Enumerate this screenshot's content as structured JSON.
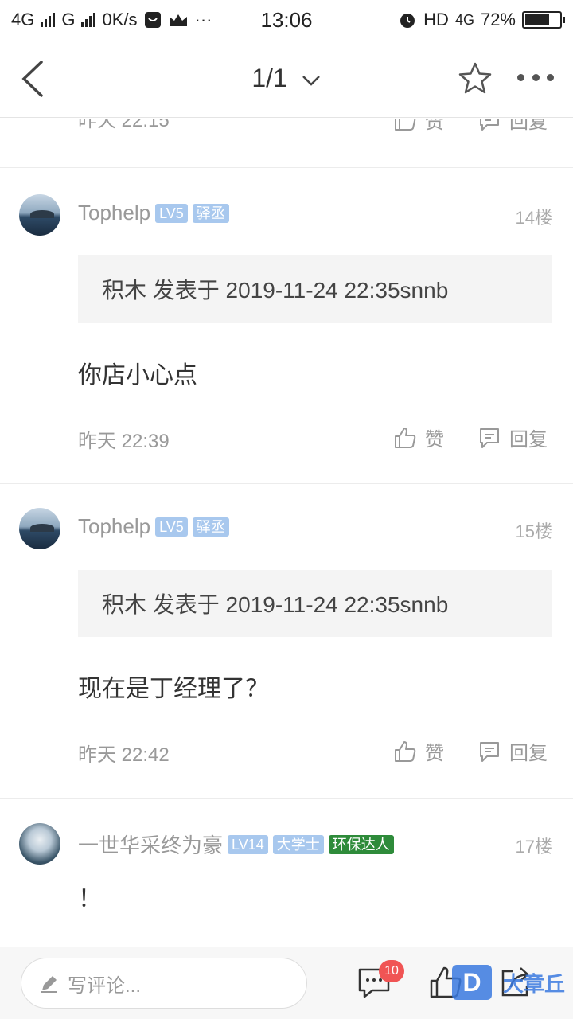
{
  "status_bar": {
    "net1": "4G",
    "net2": "G",
    "speed": "0K/s",
    "time": "13:06",
    "hd": "HD",
    "net3": "4G",
    "battery": "72%",
    "battery_level": 0.72
  },
  "nav": {
    "title": "1/1"
  },
  "prev_post": {
    "time": "昨天 22:15",
    "like": "赞",
    "reply": "回复"
  },
  "posts": [
    {
      "username": "Tophelp",
      "badges": [
        "LV5",
        "驿丞"
      ],
      "floor": "14楼",
      "quote": "积木 发表于 2019-11-24 22:35snnb",
      "text": "你店小心点",
      "time": "昨天 22:39",
      "like": "赞",
      "reply": "回复"
    },
    {
      "username": "Tophelp",
      "badges": [
        "LV5",
        "驿丞"
      ],
      "floor": "15楼",
      "quote": "积木 发表于 2019-11-24 22:35snnb",
      "text": "现在是丁经理了？",
      "time": "昨天 22:42",
      "like": "赞",
      "reply": "回复"
    },
    {
      "username": "一世华采终为豪",
      "badges": [
        "LV14",
        "大学士",
        "环保达人"
      ],
      "floor": "17楼",
      "text": "！"
    }
  ],
  "bottom_bar": {
    "placeholder": "写评论...",
    "comment_count": "10",
    "watermark": "大章丘",
    "watermark_logo": "D"
  },
  "colors": {
    "badge_blue": "#a8c8ee",
    "badge_green": "#2e8b3a",
    "notification_red": "#f05454",
    "watermark_blue": "#3a7ae0"
  }
}
